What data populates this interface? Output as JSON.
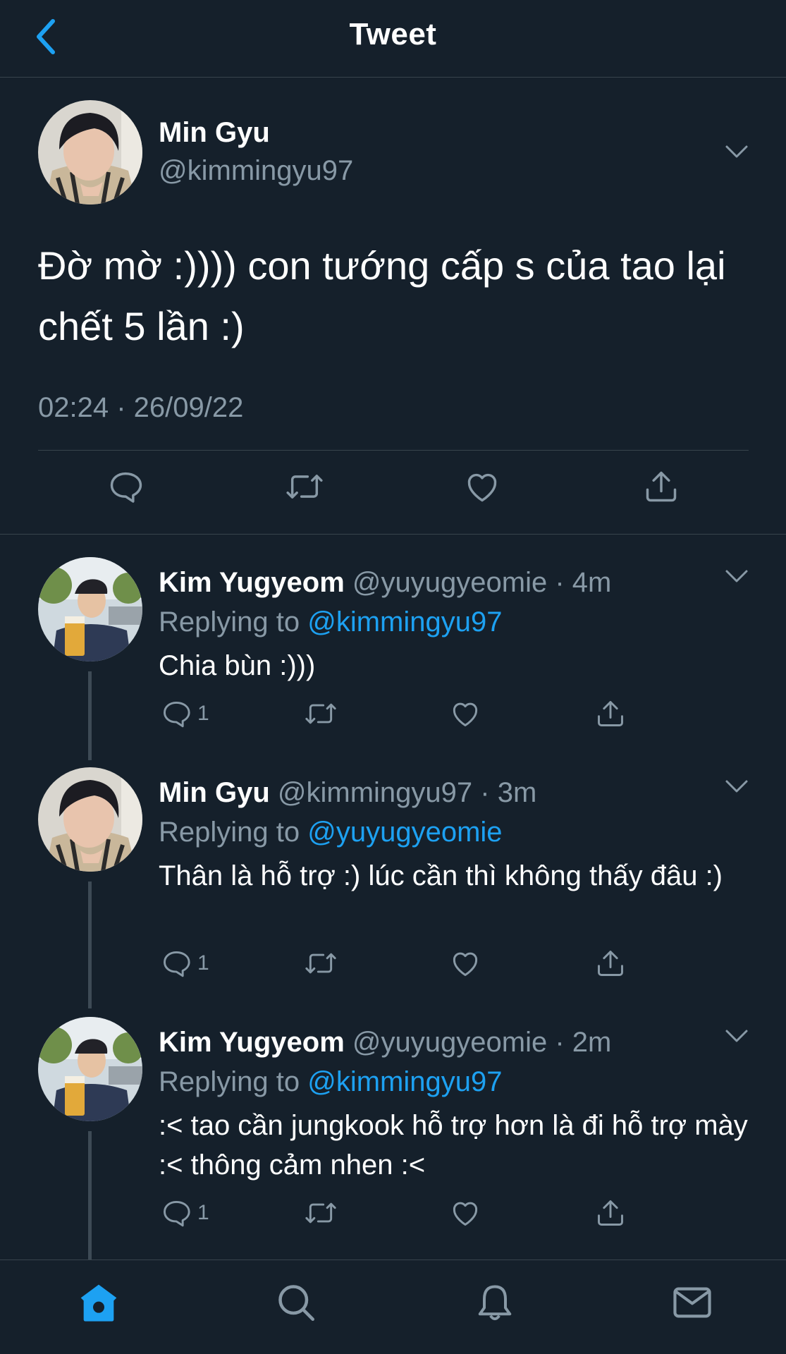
{
  "header": {
    "title": "Tweet",
    "back_icon": "chevron-left-icon"
  },
  "colors": {
    "background": "#15202b",
    "accent": "#1da1f2",
    "secondary_text": "#8899a6",
    "divider": "#38444d"
  },
  "main_tweet": {
    "name": "Min Gyu",
    "handle": "@kimmingyu97",
    "text": "Đờ mờ :)))) con tướng cấp s của tao lại chết 5 lần :)",
    "timestamp": "02:24 · 26/09/22",
    "actions": [
      "reply-icon",
      "retweet-icon",
      "like-icon",
      "share-icon"
    ]
  },
  "replies": [
    {
      "name": "Kim Yugyeom",
      "handle_time": "@yuyugyeomie · 4m",
      "replying_prefix": "Replying to ",
      "replying_to": "@kimmingyu97",
      "text": "Chia bùn :)))",
      "reply_count": "1"
    },
    {
      "name": "Min Gyu",
      "handle_time": "@kimmingyu97 · 3m",
      "replying_prefix": "Replying to ",
      "replying_to": "@yuyugyeomie",
      "text": "Thân là hỗ trợ :) lúc cần thì không thấy đâu :)",
      "reply_count": "1"
    },
    {
      "name": "Kim Yugyeom",
      "handle_time": "@yuyugyeomie · 2m",
      "replying_prefix": "Replying to ",
      "replying_to": "@kimmingyu97",
      "text": ":< tao cần jungkook hỗ trợ hơn là đi hỗ trợ mày :< thông cảm nhen :<",
      "reply_count": "1"
    }
  ],
  "bottom_nav": [
    "home-icon",
    "search-icon",
    "notifications-icon",
    "messages-icon"
  ]
}
